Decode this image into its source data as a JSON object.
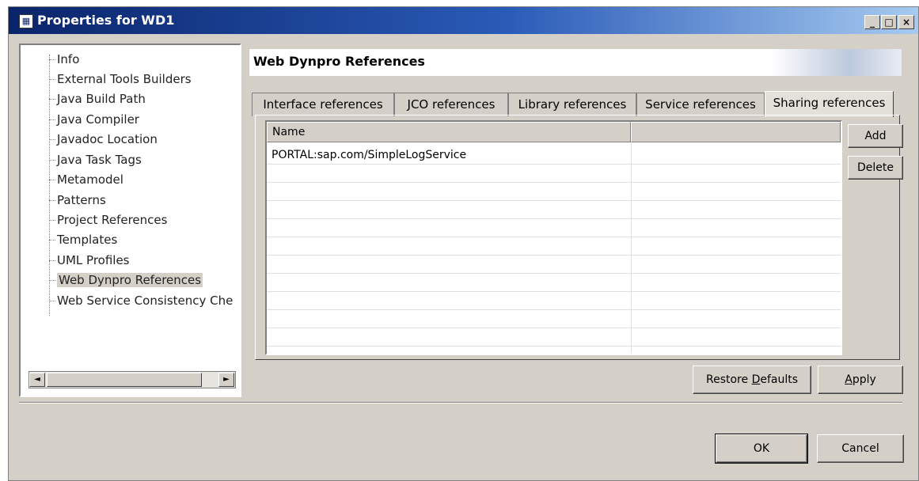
{
  "window": {
    "title": "Properties for WD1",
    "controls": {
      "minimize": "_",
      "maximize": "□",
      "close": "×"
    }
  },
  "nav": {
    "items": [
      {
        "label": "Info"
      },
      {
        "label": "External Tools Builders"
      },
      {
        "label": "Java Build Path"
      },
      {
        "label": "Java Compiler"
      },
      {
        "label": "Javadoc Location"
      },
      {
        "label": "Java Task Tags"
      },
      {
        "label": "Metamodel"
      },
      {
        "label": "Patterns"
      },
      {
        "label": "Project References"
      },
      {
        "label": "Templates"
      },
      {
        "label": "UML Profiles"
      },
      {
        "label": "Web Dynpro References",
        "selected": true
      },
      {
        "label": "Web Service Consistency Che"
      }
    ],
    "scroll_left": "◄",
    "scroll_right": "►"
  },
  "section": {
    "title": "Web Dynpro References"
  },
  "tabs": [
    {
      "label": "Interface references"
    },
    {
      "label": "JCO references"
    },
    {
      "label": "Library references"
    },
    {
      "label": "Service references"
    },
    {
      "label": "Sharing references",
      "active": true
    }
  ],
  "table": {
    "columns": [
      "Name",
      ""
    ],
    "rows": [
      [
        "PORTAL:sap.com/SimpleLogService",
        ""
      ]
    ]
  },
  "side_buttons": {
    "add": "Add",
    "delete": "Delete"
  },
  "page_buttons": {
    "restore_pre": "Restore ",
    "restore_u": "D",
    "restore_post": "efaults",
    "apply_u": "A",
    "apply_post": "pply"
  },
  "dialog_buttons": {
    "ok": "OK",
    "cancel": "Cancel"
  },
  "colors": {
    "titlebar_start": "#0a246a",
    "titlebar_end": "#a6caf0",
    "dialog_bg": "#d4d0c8"
  }
}
